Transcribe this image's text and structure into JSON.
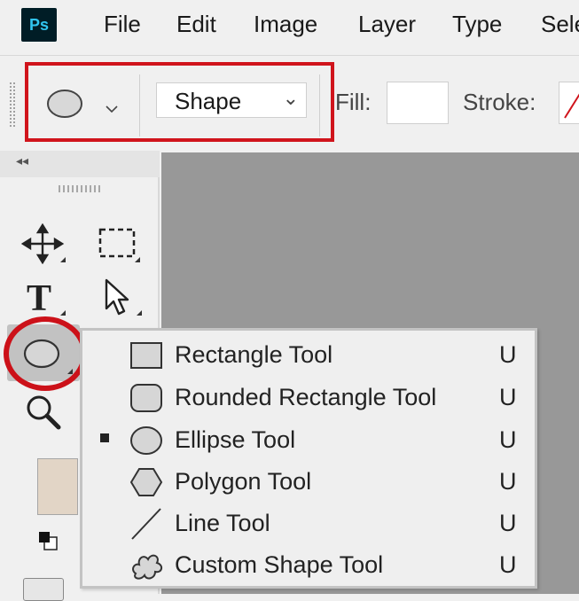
{
  "app": {
    "logo_text": "Ps"
  },
  "menubar": {
    "items": [
      "File",
      "Edit",
      "Image",
      "Layer",
      "Type",
      "Sele"
    ]
  },
  "options_bar": {
    "tool_preset_icon": "ellipse-icon",
    "mode_value": "Shape",
    "fill_label": "Fill:",
    "stroke_label": "Stroke:",
    "fill_color": "#ffffff"
  },
  "panel": {
    "collapse_glyph": "◂◂"
  },
  "flyout": {
    "items": [
      {
        "label": "Rectangle Tool",
        "shortcut": "U",
        "icon": "rectangle-icon",
        "selected": false
      },
      {
        "label": "Rounded Rectangle Tool",
        "shortcut": "U",
        "icon": "rounded-rectangle-icon",
        "selected": false
      },
      {
        "label": "Ellipse Tool",
        "shortcut": "U",
        "icon": "ellipse-icon",
        "selected": true
      },
      {
        "label": "Polygon Tool",
        "shortcut": "U",
        "icon": "polygon-icon",
        "selected": false
      },
      {
        "label": "Line Tool",
        "shortcut": "U",
        "icon": "line-icon",
        "selected": false
      },
      {
        "label": "Custom Shape Tool",
        "shortcut": "U",
        "icon": "custom-shape-icon",
        "selected": false
      }
    ]
  },
  "colors": {
    "highlight_red": "#d0141c",
    "canvas_gray": "#989898",
    "foreground_swatch": "#e2d5c6"
  }
}
